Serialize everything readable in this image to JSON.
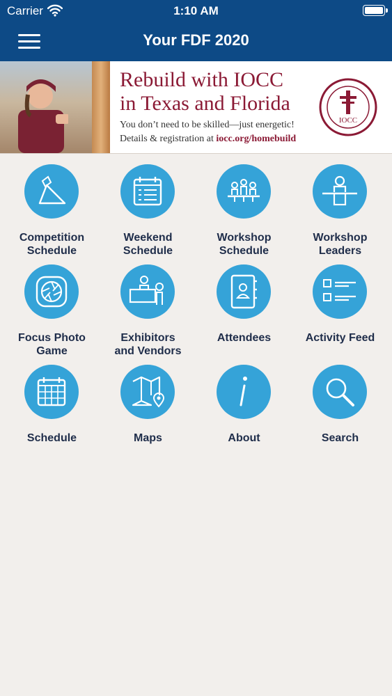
{
  "status_bar": {
    "carrier": "Carrier",
    "time": "1:10 AM"
  },
  "nav": {
    "title": "Your FDF 2020"
  },
  "banner": {
    "headline_line1": "Rebuild with IOCC",
    "headline_line2": "in Texas and Florida",
    "tagline": "You don’t need to be skilled—just energetic!",
    "details_prefix": "Details & registration at ",
    "details_link": "iocc.org/homebuild",
    "seal_text": "International Orthodox Christian Charities",
    "seal_abbrev": "IOCC"
  },
  "tiles": [
    {
      "line1": "Competition",
      "line2": "Schedule",
      "icon": "competition-icon"
    },
    {
      "line1": "Weekend",
      "line2": "Schedule",
      "icon": "calendar-list-icon"
    },
    {
      "line1": "Workshop",
      "line2": "Schedule",
      "icon": "group-table-icon"
    },
    {
      "line1": "Workshop",
      "line2": "Leaders",
      "icon": "speaker-podium-icon"
    },
    {
      "line1": "Focus Photo",
      "line2": "Game",
      "icon": "camera-aperture-icon"
    },
    {
      "line1": "Exhibitors",
      "line2": "and Vendors",
      "icon": "booth-icon"
    },
    {
      "line1": "Attendees",
      "line2": "",
      "icon": "address-book-icon"
    },
    {
      "line1": "Activity Feed",
      "line2": "",
      "icon": "checklist-icon"
    },
    {
      "line1": "Schedule",
      "line2": "",
      "icon": "calendar-grid-icon"
    },
    {
      "line1": "Maps",
      "line2": "",
      "icon": "map-pin-icon"
    },
    {
      "line1": "About",
      "line2": "",
      "icon": "info-icon"
    },
    {
      "line1": "Search",
      "line2": "",
      "icon": "magnifier-icon"
    }
  ],
  "colors": {
    "nav": "#0d4a86",
    "icon_circle": "#35a3d8",
    "banner_accent": "#8b1a35",
    "background": "#f2efec"
  }
}
